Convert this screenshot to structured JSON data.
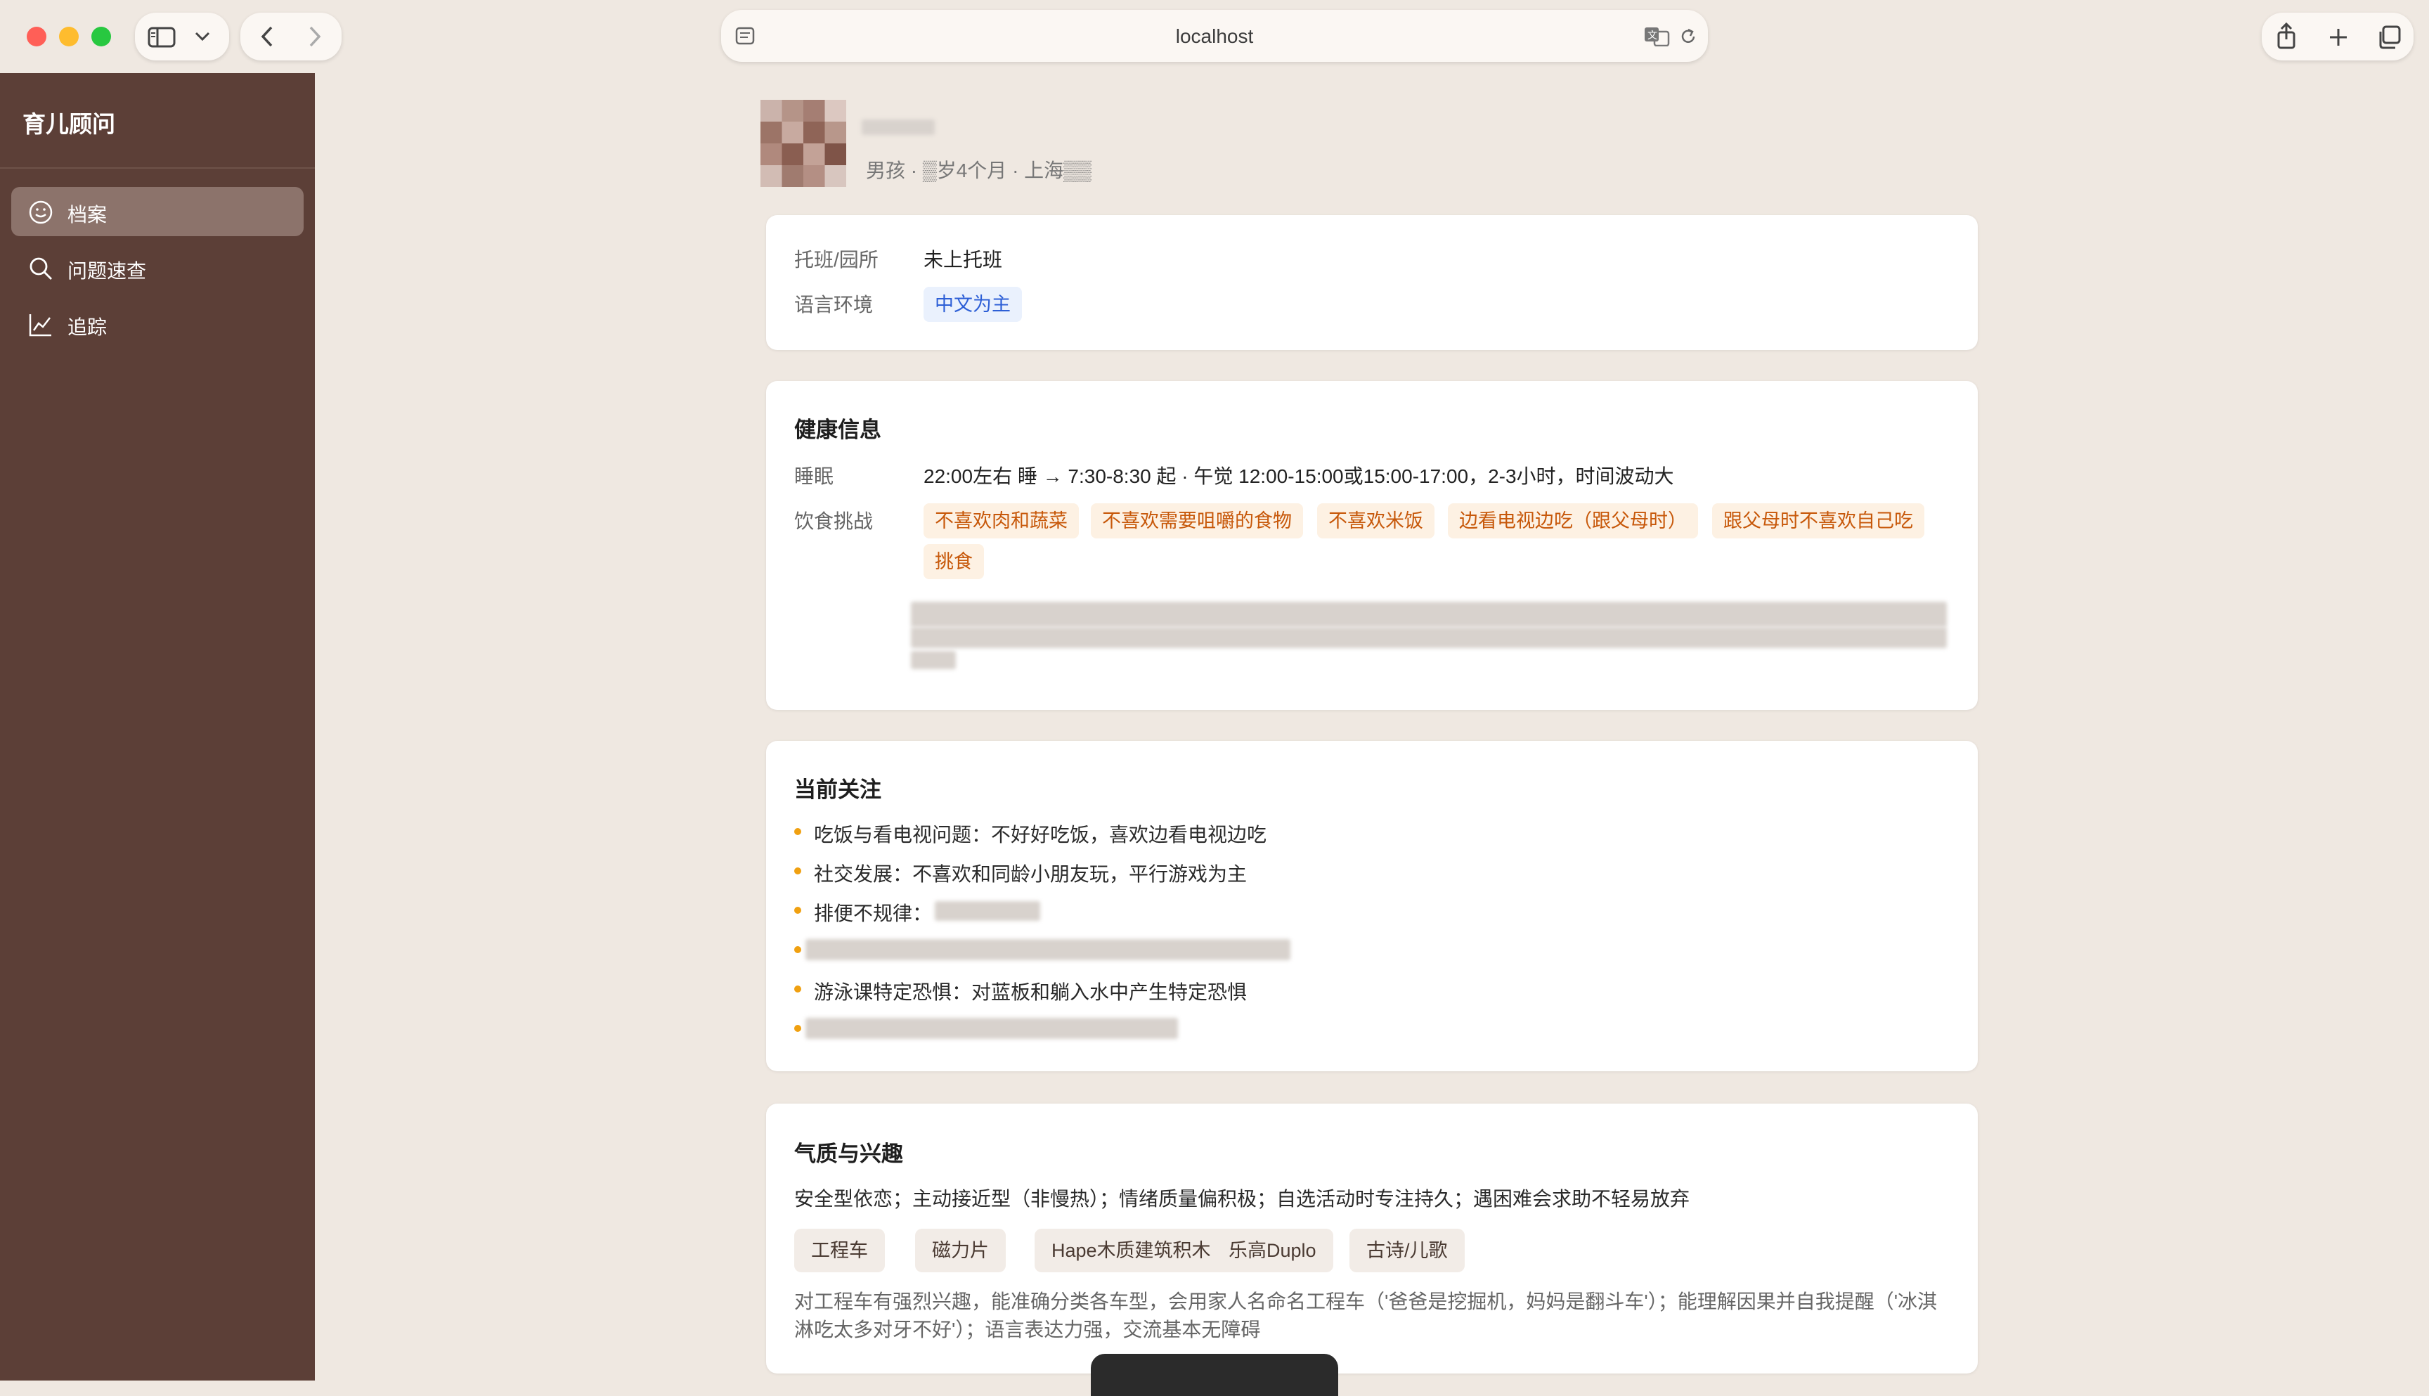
{
  "browser": {
    "address": "localhost",
    "traffic_colors": {
      "close": "#ff5f57",
      "minimize": "#febc2e",
      "zoom": "#28c840"
    },
    "icons": [
      "sidebar-toggle-icon",
      "chevron-down-icon",
      "back-arrow-icon",
      "forward-arrow-icon",
      "page-menu-icon",
      "translate-icon",
      "reload-icon",
      "share-icon",
      "new-tab-icon",
      "tab-overview-icon"
    ]
  },
  "sidebar": {
    "title": "育儿顾问",
    "items": [
      {
        "label": "档案",
        "icon": "smiley-icon",
        "active": true
      },
      {
        "label": "问题速查",
        "icon": "search-icon",
        "active": false
      },
      {
        "label": "追踪",
        "icon": "chart-line-icon",
        "active": false
      }
    ]
  },
  "profile": {
    "meta": "男孩 · ▒岁4个月 · 上海▒▒"
  },
  "basic_card": {
    "rows": [
      {
        "label": "托班/园所",
        "value": "未上托班"
      },
      {
        "label": "语言环境",
        "tag": "中文为主"
      }
    ]
  },
  "health_card": {
    "title": "健康信息",
    "sleep_label": "睡眠",
    "sleep_value": "22:00左右 睡 → 7:30-8:30 起 · 午觉 12:00-15:00或15:00-17:00，2-3小时，时间波动大",
    "diet_label": "饮食挑战",
    "diet_tags": [
      "不喜欢肉和蔬菜",
      "不喜欢需要咀嚼的食物",
      "不喜欢米饭",
      "边看电视边吃（跟父母时）",
      "跟父母时不喜欢自己吃",
      "挑食"
    ]
  },
  "concerns_card": {
    "title": "当前关注",
    "items": [
      "吃饭与看电视问题：不好好吃饭，喜欢边看电视边吃",
      "社交发展：不喜欢和同龄小朋友玩，平行游戏为主",
      "排便不规律：",
      "游泳课特定恐惧：对蓝板和躺入水中产生特定恐惧"
    ]
  },
  "temperament_card": {
    "title": "气质与兴趣",
    "summary": "安全型依恋；主动接近型（非慢热）；情绪质量偏积极；自选活动时专注持久；遇困难会求助不轻易放弃",
    "interests": [
      "工程车",
      "磁力片",
      "Hape木质建筑积木",
      "乐高Duplo",
      "古诗/儿歌"
    ],
    "description": "对工程车有强烈兴趣，能准确分类各车型，会用家人名命名工程车（'爸爸是挖掘机，妈妈是翻斗车'）；能理解因果并自我提醒（'冰淇淋吃太多对牙不好'）；语言表达力强，交流基本无障碍"
  },
  "colors": {
    "sidebar_bg": "#5c3f37",
    "page_bg": "#efe8e1",
    "bullet": "#f0a010",
    "tag_orange_text": "#c7580a",
    "tag_blue_text": "#2d5fd6"
  }
}
